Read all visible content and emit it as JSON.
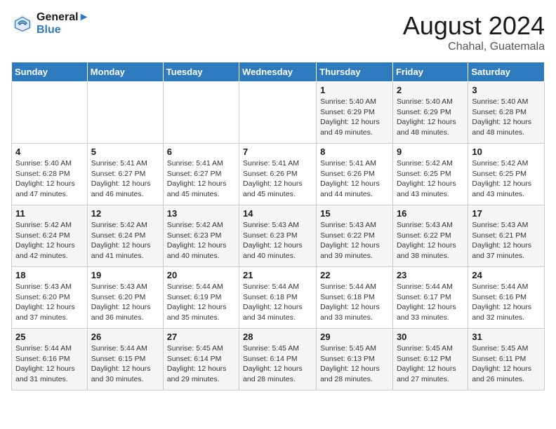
{
  "header": {
    "logo_line1": "General",
    "logo_line2": "Blue",
    "month_title": "August 2024",
    "location": "Chahal, Guatemala"
  },
  "days_of_week": [
    "Sunday",
    "Monday",
    "Tuesday",
    "Wednesday",
    "Thursday",
    "Friday",
    "Saturday"
  ],
  "weeks": [
    [
      {
        "day": "",
        "info": ""
      },
      {
        "day": "",
        "info": ""
      },
      {
        "day": "",
        "info": ""
      },
      {
        "day": "",
        "info": ""
      },
      {
        "day": "1",
        "info": "Sunrise: 5:40 AM\nSunset: 6:29 PM\nDaylight: 12 hours\nand 49 minutes."
      },
      {
        "day": "2",
        "info": "Sunrise: 5:40 AM\nSunset: 6:29 PM\nDaylight: 12 hours\nand 48 minutes."
      },
      {
        "day": "3",
        "info": "Sunrise: 5:40 AM\nSunset: 6:28 PM\nDaylight: 12 hours\nand 48 minutes."
      }
    ],
    [
      {
        "day": "4",
        "info": "Sunrise: 5:40 AM\nSunset: 6:28 PM\nDaylight: 12 hours\nand 47 minutes."
      },
      {
        "day": "5",
        "info": "Sunrise: 5:41 AM\nSunset: 6:27 PM\nDaylight: 12 hours\nand 46 minutes."
      },
      {
        "day": "6",
        "info": "Sunrise: 5:41 AM\nSunset: 6:27 PM\nDaylight: 12 hours\nand 45 minutes."
      },
      {
        "day": "7",
        "info": "Sunrise: 5:41 AM\nSunset: 6:26 PM\nDaylight: 12 hours\nand 45 minutes."
      },
      {
        "day": "8",
        "info": "Sunrise: 5:41 AM\nSunset: 6:26 PM\nDaylight: 12 hours\nand 44 minutes."
      },
      {
        "day": "9",
        "info": "Sunrise: 5:42 AM\nSunset: 6:25 PM\nDaylight: 12 hours\nand 43 minutes."
      },
      {
        "day": "10",
        "info": "Sunrise: 5:42 AM\nSunset: 6:25 PM\nDaylight: 12 hours\nand 43 minutes."
      }
    ],
    [
      {
        "day": "11",
        "info": "Sunrise: 5:42 AM\nSunset: 6:24 PM\nDaylight: 12 hours\nand 42 minutes."
      },
      {
        "day": "12",
        "info": "Sunrise: 5:42 AM\nSunset: 6:24 PM\nDaylight: 12 hours\nand 41 minutes."
      },
      {
        "day": "13",
        "info": "Sunrise: 5:42 AM\nSunset: 6:23 PM\nDaylight: 12 hours\nand 40 minutes."
      },
      {
        "day": "14",
        "info": "Sunrise: 5:43 AM\nSunset: 6:23 PM\nDaylight: 12 hours\nand 40 minutes."
      },
      {
        "day": "15",
        "info": "Sunrise: 5:43 AM\nSunset: 6:22 PM\nDaylight: 12 hours\nand 39 minutes."
      },
      {
        "day": "16",
        "info": "Sunrise: 5:43 AM\nSunset: 6:22 PM\nDaylight: 12 hours\nand 38 minutes."
      },
      {
        "day": "17",
        "info": "Sunrise: 5:43 AM\nSunset: 6:21 PM\nDaylight: 12 hours\nand 37 minutes."
      }
    ],
    [
      {
        "day": "18",
        "info": "Sunrise: 5:43 AM\nSunset: 6:20 PM\nDaylight: 12 hours\nand 37 minutes."
      },
      {
        "day": "19",
        "info": "Sunrise: 5:43 AM\nSunset: 6:20 PM\nDaylight: 12 hours\nand 36 minutes."
      },
      {
        "day": "20",
        "info": "Sunrise: 5:44 AM\nSunset: 6:19 PM\nDaylight: 12 hours\nand 35 minutes."
      },
      {
        "day": "21",
        "info": "Sunrise: 5:44 AM\nSunset: 6:18 PM\nDaylight: 12 hours\nand 34 minutes."
      },
      {
        "day": "22",
        "info": "Sunrise: 5:44 AM\nSunset: 6:18 PM\nDaylight: 12 hours\nand 33 minutes."
      },
      {
        "day": "23",
        "info": "Sunrise: 5:44 AM\nSunset: 6:17 PM\nDaylight: 12 hours\nand 33 minutes."
      },
      {
        "day": "24",
        "info": "Sunrise: 5:44 AM\nSunset: 6:16 PM\nDaylight: 12 hours\nand 32 minutes."
      }
    ],
    [
      {
        "day": "25",
        "info": "Sunrise: 5:44 AM\nSunset: 6:16 PM\nDaylight: 12 hours\nand 31 minutes."
      },
      {
        "day": "26",
        "info": "Sunrise: 5:44 AM\nSunset: 6:15 PM\nDaylight: 12 hours\nand 30 minutes."
      },
      {
        "day": "27",
        "info": "Sunrise: 5:45 AM\nSunset: 6:14 PM\nDaylight: 12 hours\nand 29 minutes."
      },
      {
        "day": "28",
        "info": "Sunrise: 5:45 AM\nSunset: 6:14 PM\nDaylight: 12 hours\nand 28 minutes."
      },
      {
        "day": "29",
        "info": "Sunrise: 5:45 AM\nSunset: 6:13 PM\nDaylight: 12 hours\nand 28 minutes."
      },
      {
        "day": "30",
        "info": "Sunrise: 5:45 AM\nSunset: 6:12 PM\nDaylight: 12 hours\nand 27 minutes."
      },
      {
        "day": "31",
        "info": "Sunrise: 5:45 AM\nSunset: 6:11 PM\nDaylight: 12 hours\nand 26 minutes."
      }
    ]
  ]
}
